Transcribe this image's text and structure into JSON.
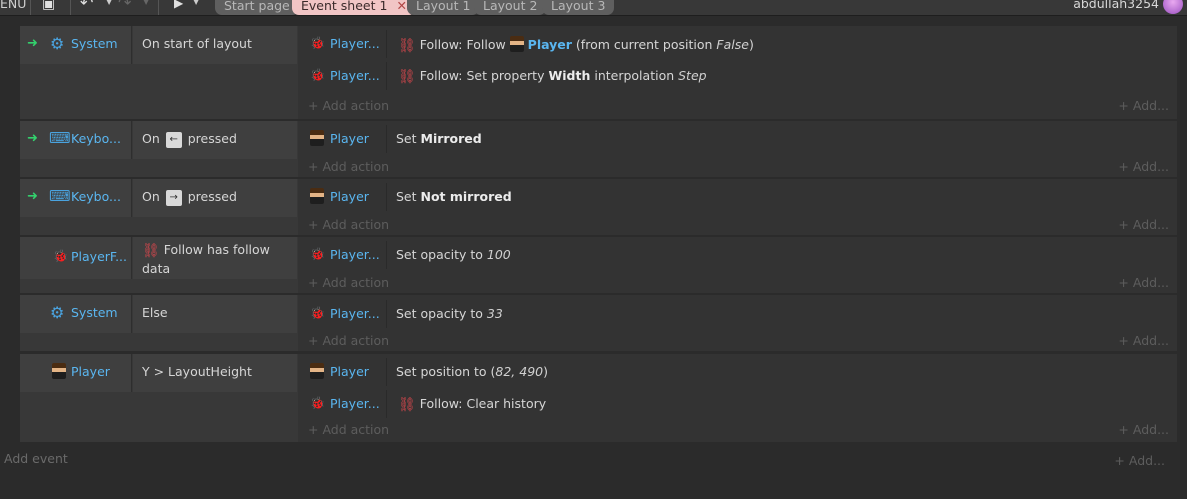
{
  "menu_label": "ENU",
  "toolbar": {
    "save_icon": "save-icon",
    "undo_icon": "undo-icon",
    "redo_icon": "redo-icon",
    "play_icon": "play-icon"
  },
  "tabs": [
    {
      "label": "Start page"
    },
    {
      "label": "Event sheet 1",
      "close": "✕"
    },
    {
      "label": "Layout 1"
    },
    {
      "label": "Layout 2"
    },
    {
      "label": "Layout 3"
    }
  ],
  "user": {
    "name": "abdullah3254"
  },
  "events": [
    {
      "condition": {
        "object": "System",
        "text": "On start of layout"
      },
      "actions": [
        {
          "object": "Player...",
          "pre": "Follow: Follow ",
          "obj": "Player",
          "post": " (from current position ",
          "val": "False",
          "end": ")"
        },
        {
          "object": "Player...",
          "pre": "Follow: Set property ",
          "bold": "Width",
          "mid": " interpolation ",
          "val": "Step"
        }
      ]
    },
    {
      "condition": {
        "object": "Keybo...",
        "pre": "On",
        "key": "←",
        "post": "pressed"
      },
      "actions": [
        {
          "object": "Player",
          "pre": "Set ",
          "bold": "Mirrored"
        }
      ]
    },
    {
      "condition": {
        "object": "Keybo...",
        "pre": "On",
        "key": "→",
        "post": "pressed"
      },
      "actions": [
        {
          "object": "Player",
          "pre": "Set ",
          "bold": "Not mirrored"
        }
      ]
    },
    {
      "condition": {
        "object": "PlayerF...",
        "line1": "Follow has follow",
        "line2": "data"
      },
      "actions": [
        {
          "object": "Player...",
          "pre": "Set opacity to ",
          "val": "100"
        }
      ]
    },
    {
      "condition": {
        "object": "System",
        "text": "Else"
      },
      "actions": [
        {
          "object": "Player...",
          "pre": "Set opacity to ",
          "val": "33"
        }
      ]
    },
    {
      "condition": {
        "object": "Player",
        "text": "Y > LayoutHeight"
      },
      "actions": [
        {
          "object": "Player",
          "pre": "Set position to (",
          "val": "82, 490",
          "end": ")"
        },
        {
          "object": "Player...",
          "text": "Follow: Clear history"
        }
      ]
    }
  ],
  "add_action_label": "+ Add action",
  "add_right_label": "+ Add...",
  "add_event_label": "Add event"
}
